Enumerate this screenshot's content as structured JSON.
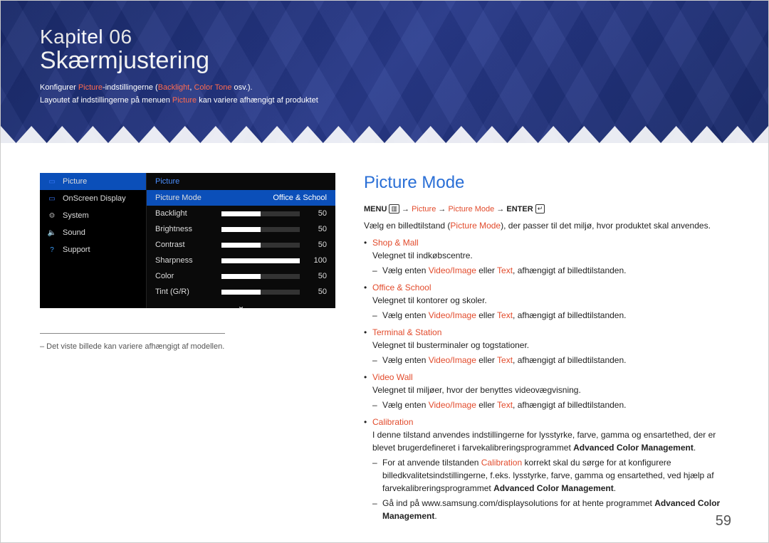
{
  "banner": {
    "chapter_label": "Kapitel 06",
    "chapter_title": "Skærmjustering",
    "sub1_pre": "Konfigurer ",
    "sub1_hl1": "Picture",
    "sub1_mid": "-indstillingerne (",
    "sub1_hl2": "Backlight",
    "sub1_sep": ", ",
    "sub1_hl3": "Color Tone",
    "sub1_post": " osv.).",
    "sub2_pre": "Layoutet af indstillingerne på menuen ",
    "sub2_hl": "Picture",
    "sub2_post": " kan variere afhængigt af produktet"
  },
  "osd": {
    "nav": [
      {
        "label": "Picture",
        "icon": "▭",
        "active": true,
        "color": "#3a7bff"
      },
      {
        "label": "OnScreen Display",
        "icon": "▭",
        "active": false,
        "color": "#3a7bff"
      },
      {
        "label": "System",
        "icon": "⚙",
        "active": false,
        "color": "#aaa"
      },
      {
        "label": "Sound",
        "icon": "🔈",
        "active": false,
        "color": "#aaa"
      },
      {
        "label": "Support",
        "icon": "?",
        "active": false,
        "color": "#3aa0ff"
      }
    ],
    "panel_header": "Picture",
    "rows": [
      {
        "name": "Picture Mode",
        "type": "mode",
        "value": "Office & School",
        "selected": true
      },
      {
        "name": "Backlight",
        "type": "bar",
        "value": 50,
        "max": 100
      },
      {
        "name": "Brightness",
        "type": "bar",
        "value": 50,
        "max": 100
      },
      {
        "name": "Contrast",
        "type": "bar",
        "value": 50,
        "max": 100
      },
      {
        "name": "Sharpness",
        "type": "bar",
        "value": 100,
        "max": 100
      },
      {
        "name": "Color",
        "type": "bar",
        "value": 50,
        "max": 100
      },
      {
        "name": "Tint (G/R)",
        "type": "bar",
        "value": 50,
        "max": 100
      }
    ],
    "more_glyph": "⌄"
  },
  "left_note": "– Det viste billede kan variere afhængigt af modellen.",
  "section_title": "Picture Mode",
  "path": {
    "menu": "MENU",
    "menu_icon": "▥",
    "arrow": "→",
    "p1": "Picture",
    "p2": "Picture Mode",
    "enter": "ENTER",
    "enter_icon": "↵"
  },
  "intro_pre": "Vælg en billedtilstand (",
  "intro_hl": "Picture Mode",
  "intro_post": "), der passer til det miljø, hvor produktet skal anvendes.",
  "modes": [
    {
      "name": "Shop & Mall",
      "desc": "Velegnet til indkøbscentre.",
      "subs": [
        {
          "pre": "Vælg enten ",
          "hl1": "Video/Image",
          "mid": " eller ",
          "hl2": "Text",
          "post": ", afhængigt af billedtilstanden."
        }
      ]
    },
    {
      "name": "Office & School",
      "desc": "Velegnet til kontorer og skoler.",
      "subs": [
        {
          "pre": "Vælg enten ",
          "hl1": "Video/Image",
          "mid": " eller ",
          "hl2": "Text",
          "post": ", afhængigt af billedtilstanden."
        }
      ]
    },
    {
      "name": "Terminal & Station",
      "desc": "Velegnet til busterminaler og togstationer.",
      "subs": [
        {
          "pre": "Vælg enten ",
          "hl1": "Video/Image",
          "mid": " eller ",
          "hl2": "Text",
          "post": ", afhængigt af billedtilstanden."
        }
      ]
    },
    {
      "name": "Video Wall",
      "desc": "Velegnet til miljøer, hvor der benyttes videovægvisning.",
      "subs": [
        {
          "pre": "Vælg enten ",
          "hl1": "Video/Image",
          "mid": " eller ",
          "hl2": "Text",
          "post": ", afhængigt af billedtilstanden."
        }
      ]
    },
    {
      "name": "Calibration",
      "desc_pre": "I denne tilstand anvendes indstillingerne for lysstyrke, farve, gamma og ensartethed, der er blevet brugerdefineret i farvekalibreringsprogrammet ",
      "desc_strong": "Advanced Color Management",
      "desc_post": ".",
      "subs": [
        {
          "pre": "For at anvende tilstanden ",
          "hl1": "Calibration",
          "mid": " korrekt skal du sørge for at konfigurere billedkvalitetsindstillingerne, f.eks. lysstyrke, farve, gamma og ensartethed, ved hjælp af farvekalibreringsprogrammet ",
          "strong": "Advanced Color Management",
          "post": "."
        },
        {
          "pre": "Gå ind på www.samsung.com/displaysolutions for at hente programmet ",
          "strong": "Advanced Color Management",
          "post": "."
        }
      ]
    }
  ],
  "page_number": "59"
}
